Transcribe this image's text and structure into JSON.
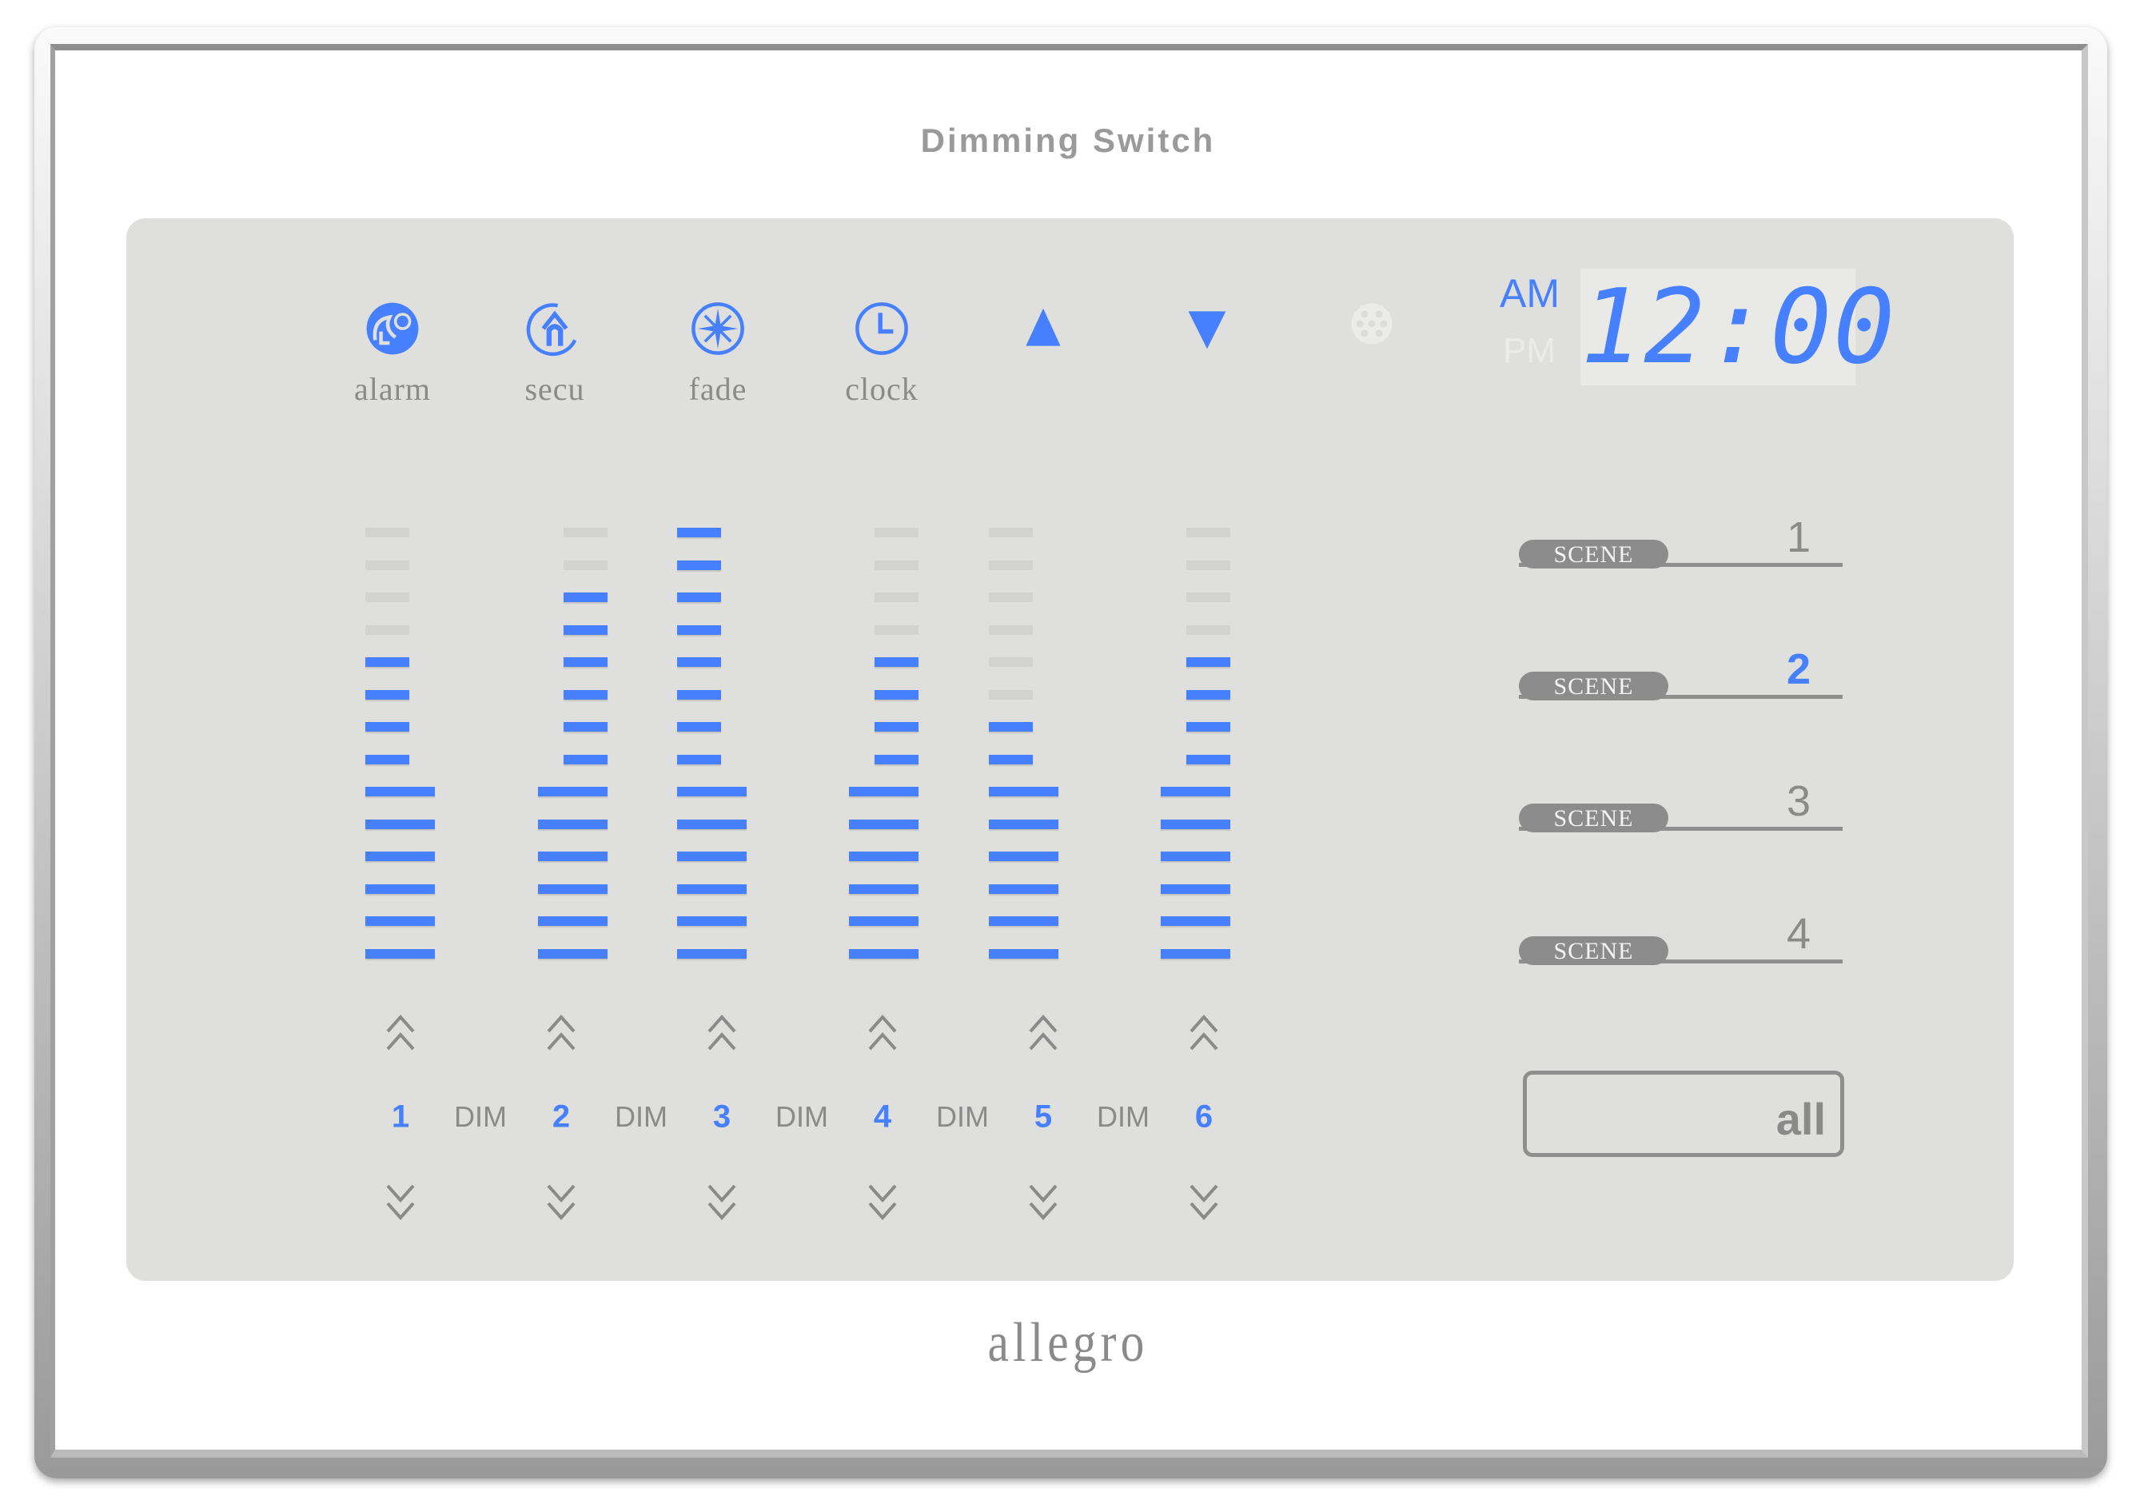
{
  "title": "Dimming Switch",
  "brand": "allegro",
  "colors": {
    "accent": "#4680ff",
    "unlit": "#d2d2d0",
    "text": "#8a8a8a",
    "panel": "#dfdfdd"
  },
  "top_icons": [
    {
      "name": "alarm",
      "label": "alarm",
      "icon": "alarm-icon"
    },
    {
      "name": "secu",
      "label": "secu",
      "icon": "security-home-icon"
    },
    {
      "name": "fade",
      "label": "fade",
      "icon": "fade-sparkle-icon"
    },
    {
      "name": "clock",
      "label": "clock",
      "icon": "clock-icon"
    },
    {
      "name": "up",
      "label": "",
      "icon": "triangle-up-icon"
    },
    {
      "name": "down",
      "label": "",
      "icon": "triangle-down-icon"
    },
    {
      "name": "sensor",
      "label": "",
      "icon": "sensor-grid-icon"
    }
  ],
  "clock": {
    "am": "AM",
    "pm": "PM",
    "active_period": "AM",
    "time": "12:00"
  },
  "channels": [
    {
      "number": "1",
      "level": 10,
      "segments": 14
    },
    {
      "number": "2",
      "level": 12,
      "segments": 14
    },
    {
      "number": "3",
      "level": 14,
      "segments": 14
    },
    {
      "number": "4",
      "level": 10,
      "segments": 14
    },
    {
      "number": "5",
      "level": 8,
      "segments": 14
    },
    {
      "number": "6",
      "level": 10,
      "segments": 14
    }
  ],
  "dim_label": "DIM",
  "scenes": [
    {
      "label": "SCENE",
      "number": "1",
      "active": false
    },
    {
      "label": "SCENE",
      "number": "2",
      "active": true
    },
    {
      "label": "SCENE",
      "number": "3",
      "active": false
    },
    {
      "label": "SCENE",
      "number": "4",
      "active": false
    }
  ],
  "all_button": "all"
}
